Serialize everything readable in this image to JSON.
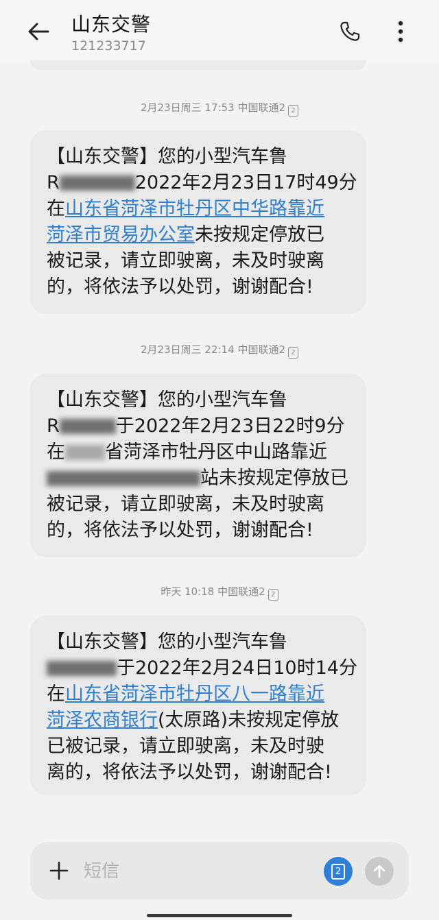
{
  "header": {
    "title": "山东交警",
    "number": "121233717"
  },
  "messages": [
    {
      "timestamp": "2月23日周三 17:53",
      "carrier": "中国联通2",
      "sim": "2",
      "lines": {
        "l1": "【山东交警】您的小型汽车鲁",
        "l2_prefix": "R",
        "l2_rest": "2022年2月23日17时49分",
        "l3_prefix": "在",
        "l3_link": "山东省菏泽市牡丹区中华路靠近",
        "l4_link": "菏泽市贸易办公室",
        "l4_rest": "未按规定停放已",
        "l5": "被记录，请立即驶离，未及时驶离",
        "l6": "的，将依法予以处罚，谢谢配合!"
      }
    },
    {
      "timestamp": "2月23日周三 22:14",
      "carrier": "中国联通2",
      "sim": "2",
      "lines": {
        "l1": "【山东交警】您的小型汽车鲁",
        "l2_prefix": "R",
        "l2_rest": "于2022年2月23日22时9分",
        "l3_prefix": "在",
        "l3_rest": "省菏泽市牡丹区中山路靠近",
        "l4_rest": "站未按规定停放已",
        "l5": "被记录，请立即驶离，未及时驶离",
        "l6": "的，将依法予以处罚，谢谢配合!"
      }
    },
    {
      "timestamp": "昨天 10:18",
      "carrier": "中国联通2",
      "sim": "2",
      "lines": {
        "l1": "【山东交警】您的小型汽车鲁",
        "l2_rest": "于2022年2月24日10时14分",
        "l3_prefix": "在",
        "l3_link": "山东省菏泽市牡丹区八一路靠近",
        "l4_link": "菏泽农商银行",
        "l4_rest": "(太原路)未按规定停放",
        "l5": "已被记录，请立即驶离，未及时驶",
        "l6": "离的，将依法予以处罚，谢谢配合!"
      }
    }
  ],
  "composer": {
    "placeholder": "短信",
    "sim": "2"
  },
  "icons": [
    "back-arrow-icon",
    "phone-icon",
    "more-vertical-icon",
    "plus-icon",
    "sim-card-icon",
    "send-arrow-icon"
  ]
}
